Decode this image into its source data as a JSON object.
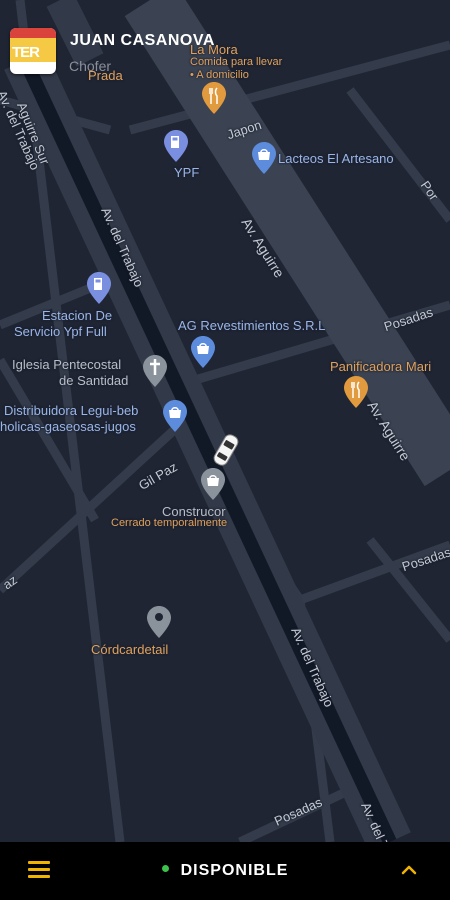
{
  "header": {
    "driver_name": "JUAN CASANOVA",
    "driver_role": "Chofer",
    "avatar_text": "TER"
  },
  "map": {
    "streets": {
      "av_del_trabajo_top": "Av. del Trabajo",
      "av_del_trabajo_mid": "Av. del Trabajo",
      "av_del_trabajo_bottom": "Av. del Trabajo",
      "av_del_trabajo_edge": "Av. del Trabajo",
      "aguirre_sur": "Aguirre Sur",
      "av_aguirre_top": "Av. Aguirre",
      "av_aguirre_bottom": "Av. Aguirre",
      "japon": "Japon",
      "posadas_mid": "Posadas",
      "posadas_right": "Posadas",
      "posadas_bottom": "Posadas",
      "gil_paz": "Gil Paz",
      "left_edge": "az",
      "right_top_edge": "Por"
    },
    "pois": {
      "prada": "Prada",
      "la_mora": "La Mora",
      "la_mora_desc_1": "Comida para llevar",
      "la_mora_desc_2": "• A domicilio",
      "ypf": "YPF",
      "lacteos": "Lacteos El Artesano",
      "estacion_1": "Estacion De",
      "estacion_2": "Servicio Ypf Full",
      "ag_revestimientos": "AG Revestimientos S.R.L",
      "iglesia_1": "Iglesia Pentecostal",
      "iglesia_2": "de Santidad",
      "distribuidora_1": "Distribuidora Legui-beb",
      "distribuidora_2": "holicas-gaseosas-jugos",
      "panificadora": "Panificadora Mari",
      "construcor": "Construcor",
      "construcor_status": "Cerrado temporalmente",
      "cordcardetail": "Córdcardetail"
    }
  },
  "bottom_bar": {
    "status_label": "DISPONIBLE",
    "status_color": "#3cc24b",
    "accent_color": "#f0b400",
    "menu_icon": "hamburger-menu-icon",
    "expand_icon": "chevron-up-icon"
  }
}
